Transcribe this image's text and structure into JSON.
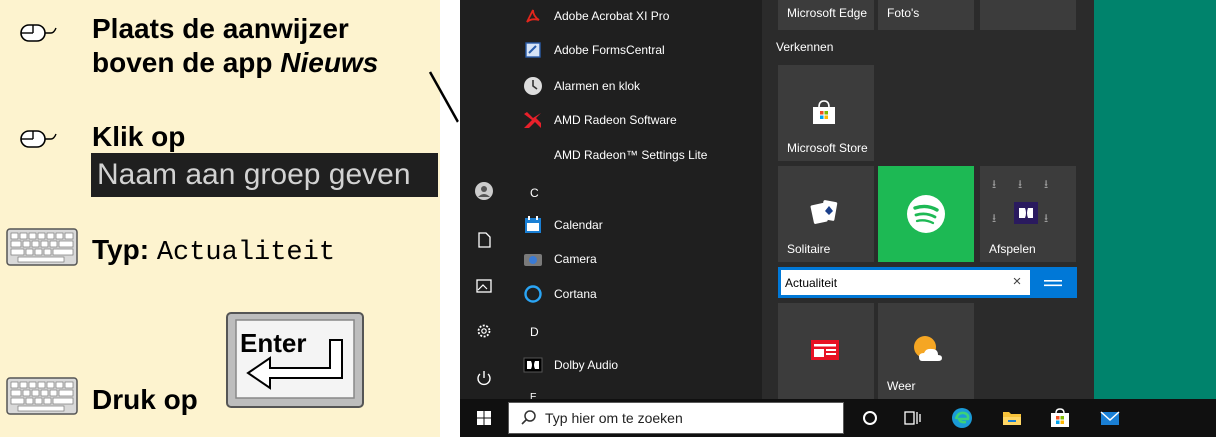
{
  "instructions": {
    "step1_line1": "Plaats de aanwijzer",
    "step1_line2_prefix": "boven de app ",
    "step1_line2_app": "Nieuws",
    "step2_text": "Klik op",
    "step2_menu_item": "Naam aan groep geven",
    "step3_label": "Typ:",
    "step3_value": "Actualiteit",
    "step4_text": "Druk op",
    "enter_key_label": "Enter"
  },
  "start_menu": {
    "apps": [
      {
        "label": "Adobe Acrobat XI Pro",
        "icon": "acrobat-icon"
      },
      {
        "label": "Adobe FormsCentral",
        "icon": "formscentral-icon"
      },
      {
        "label": "Alarmen en klok",
        "icon": "alarm-clock-icon"
      },
      {
        "label": "AMD Radeon Software",
        "icon": "amd-radeon-icon"
      },
      {
        "label": "AMD Radeon™ Settings Lite",
        "icon": ""
      },
      {
        "label": "Calendar",
        "icon": "calendar-icon"
      },
      {
        "label": "Camera",
        "icon": "camera-icon"
      },
      {
        "label": "Cortana",
        "icon": "cortana-icon"
      },
      {
        "label": "Dolby Audio",
        "icon": "dolby-icon"
      }
    ],
    "letters": [
      "C",
      "D",
      "E"
    ],
    "tile_groups": {
      "explore": "Verkennen"
    },
    "tiles": {
      "edge": "Microsoft Edge",
      "photos": "Foto's",
      "store": "Microsoft Store",
      "solitaire": "Solitaire",
      "spotify": "",
      "play": "Afspelen",
      "news": "",
      "weather": "Weer"
    },
    "rename_field": {
      "value": "Actualiteit",
      "clear": "×"
    }
  },
  "taskbar": {
    "search_placeholder": "Typ hier om te zoeken"
  },
  "colors": {
    "panel_bg": "#fdf3cf",
    "desktop": "#00836c",
    "accent": "#0078d7",
    "spotify": "#1db954"
  }
}
